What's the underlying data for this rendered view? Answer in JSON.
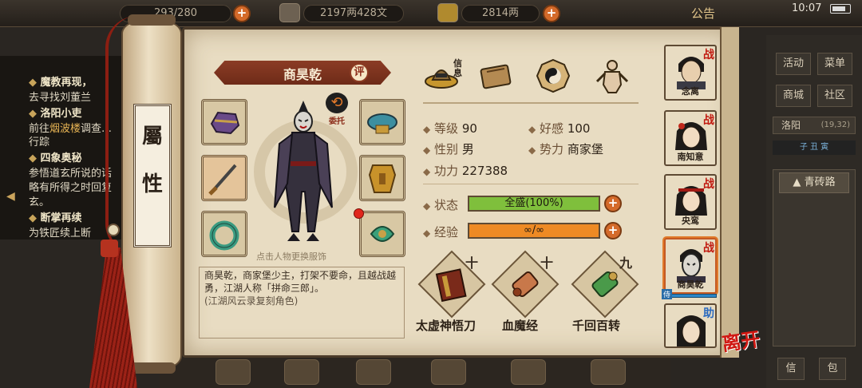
{
  "topbar": {
    "stamina": "293/280",
    "coins": "2197两428文",
    "gold": "2814两",
    "notice": "公告",
    "clock": "10:07"
  },
  "quests": [
    {
      "title": "魔教再现，",
      "detail": "去寻找刘董兰"
    },
    {
      "title": "洛阳小吏",
      "detail_prefix": "前往",
      "detail_link": "烟波楼",
      "detail_suffix": "调查…",
      "detail2": "行踪"
    },
    {
      "title": "四象奥秘",
      "detail": "参悟道玄所说的话",
      "detail2": "略有所得之时回复",
      "detail3": "玄。"
    },
    {
      "title": "断掌再续",
      "detail": "为铁匠续上断"
    }
  ],
  "right_menu": {
    "activity": "活动",
    "menu": "菜单",
    "shop": "商城",
    "community": "社区",
    "location": "洛阳",
    "coords": "(19,32)",
    "time_of_day": "子  丑  寅",
    "road": "青砖路",
    "bottom_btn1": "信",
    "bottom_btn2": "包"
  },
  "scroll": {
    "label_line1": "屬",
    "label_line2": "性"
  },
  "character": {
    "name": "商昊乾",
    "review_badge": "评",
    "entrust_label": "委托",
    "change_clothes_hint": "点击人物更换服饰",
    "description": "商昊乾，商家堡少主，打架不要命，且越战越勇，江湖人称「拼命三郎」。",
    "description_note": "(江湖风云录复刻角色)"
  },
  "tabs": [
    {
      "label": "信息",
      "icon": "hat-icon"
    },
    {
      "label": "",
      "icon": "scroll-box-icon"
    },
    {
      "label": "",
      "icon": "bagua-icon"
    },
    {
      "label": "",
      "icon": "body-icon"
    }
  ],
  "stats": {
    "level_label": "等级",
    "level": "90",
    "favor_label": "好感",
    "favor": "100",
    "gender_label": "性别",
    "gender": "男",
    "faction_label": "势力",
    "faction": "商家堡",
    "power_label": "功力",
    "power": "227388"
  },
  "bars": {
    "status_label": "状态",
    "status_text": "全盛(100%)",
    "status_fraction": 1.0,
    "status_color": "#7fbf3c",
    "exp_label": "经验",
    "exp_text": "∞/∞",
    "exp_fraction": 1.0,
    "exp_color": "#ee8a24"
  },
  "skills": [
    {
      "level": "十",
      "name": "太虚神悟刀",
      "icon": "book-icon"
    },
    {
      "level": "十",
      "name": "血魔经",
      "icon": "scroll-icon"
    },
    {
      "level": "九",
      "name": "千回百转",
      "icon": "jade-scroll-icon"
    }
  ],
  "party": [
    {
      "name": "念离",
      "badge": "战"
    },
    {
      "name": "南知意",
      "badge": "战"
    },
    {
      "name": "央鸾",
      "badge": "战"
    },
    {
      "name": "商昊乾",
      "badge": "战",
      "selected": true
    },
    {
      "name": "",
      "badge": "助"
    }
  ],
  "party_tag": "侍",
  "leave_label": "离开",
  "colors": {
    "accent": "#8b3c25",
    "paper": "#e8dcc2",
    "plus": "#d46a2a"
  }
}
